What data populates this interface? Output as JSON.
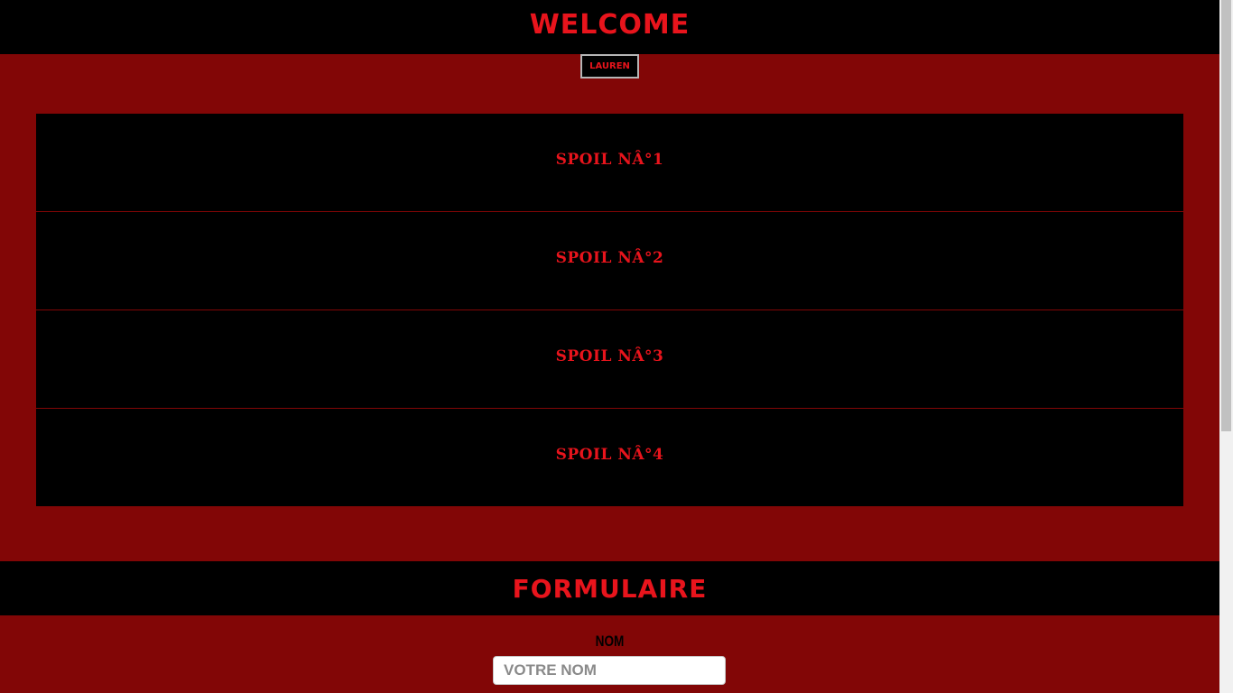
{
  "header": {
    "title": "WELCOME",
    "user_button": "LAUREN"
  },
  "spoils": [
    {
      "label": "SPOIL NÂ°1"
    },
    {
      "label": "SPOIL NÂ°2"
    },
    {
      "label": "SPOIL NÂ°3"
    },
    {
      "label": "SPOIL NÂ°4"
    }
  ],
  "form": {
    "title": "FORMULAIRE",
    "name_label": "NOM",
    "name_placeholder": "VOTRE NOM",
    "name_value": ""
  },
  "colors": {
    "background": "#820606",
    "band": "#000000",
    "accent": "#e8141c"
  }
}
